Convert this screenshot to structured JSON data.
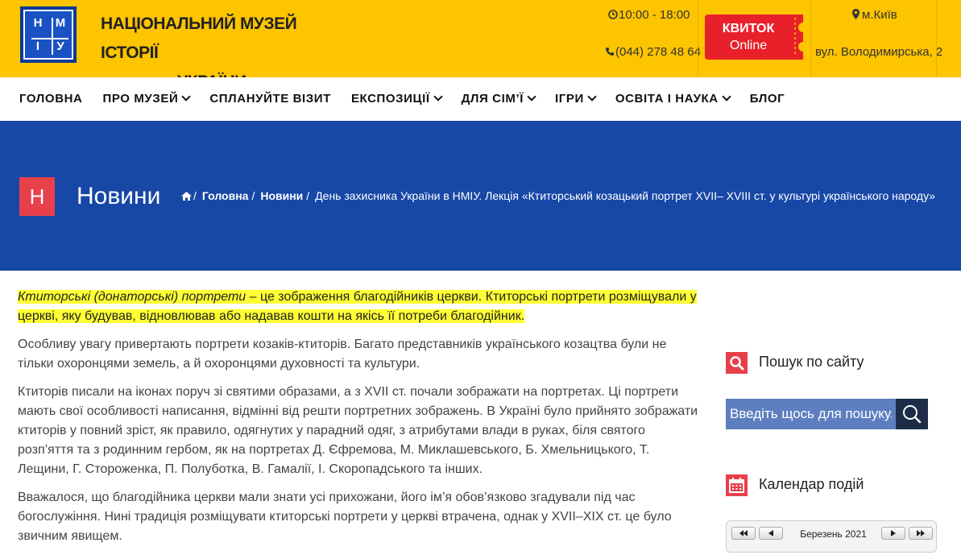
{
  "header": {
    "logo_letters": [
      "Н",
      "М",
      "І",
      "У"
    ],
    "museum_name_line1": "НАЦІОНАЛЬНИЙ МУЗЕЙ ІСТОРІЇ",
    "museum_name_line2": "УКРАЇНИ",
    "hours": "10:00 - 18:00",
    "phone": "(044) 278 48 64",
    "ticket_line1": "КВИТОК",
    "ticket_line2": "Online",
    "city": "м.Київ",
    "address": "вул. Володимирська, 2"
  },
  "nav": {
    "items": [
      {
        "label": "ГОЛОВНА"
      },
      {
        "label": "ПРО МУЗЕЙ"
      },
      {
        "label": "СПЛАНУЙТЕ ВІЗИТ"
      },
      {
        "label": "ЕКСПОЗИЦІЇ"
      },
      {
        "label": "ДЛЯ СІМ’Ї"
      },
      {
        "label": "ІГРИ"
      },
      {
        "label": "ОСВІТА І НАУКА"
      },
      {
        "label": "БЛОГ"
      }
    ]
  },
  "banner": {
    "badge_letter": "Н",
    "title": "Новини",
    "breadcrumb": [
      "Головна",
      "Новини",
      "День захисника України в НМІУ. Лекція «Ктиторський козацький портрет XVII– XVIII ст. у культурі українського народу»"
    ]
  },
  "article": {
    "highlight_term": "Ктиторські (донаторські) портрети",
    "highlight_rest": " – це зображення благодійників церкви. Ктиторські портрети розміщували у церкві, яку будував, відновлював або надавав кошти на якісь її потреби благодійник.",
    "p2": "Особливу увагу привертають портрети козаків-ктиторів. Багато представників українського козацтва були не тільки охоронцями земель, а й охоронцями духовності та культури.",
    "p3": "Ктиторів писали на іконах поруч зі святими образами, а з XVII ст. почали зображати на портретах. Ці портрети мають свої особливості написання, відмінні від решти портретних зображень. В Україні було прийнято зображати ктиторів у повний зріст, як правило, одягнутих у парадний одяг, з атрибутами влади в руках, біля святого розп’яття та з родинним гербом, як на портретах Д. Єфремова, М. Миклашевського, Б. Хмельницького, Т. Лещини, Г. Стороженка, П. Полуботка, В. Гамалії, І. Скоропадського та інших.",
    "p4": "Вважалося, що благодійника церкви мали знати усі прихожани, його ім’я обов’язково згадували під час богослужіння. Нині традиція розміщувати ктиторські портрети у церкві втрачена, однак у XVII–XIX ст. це було звичним явищем."
  },
  "sidebar": {
    "search_title": "Пошук по сайту",
    "search_placeholder": "Введіть щось для пошуку...",
    "calendar_title": "Календар подій",
    "calendar_month": "Березень 2021"
  },
  "colors": {
    "header_bg": "#fdc400",
    "banner_bg": "#1848a6",
    "accent_red": "#e8404b",
    "ticket_red": "#e8202a",
    "highlight": "#ffff33"
  },
  "icons": [
    "clock-icon",
    "phone-icon",
    "map-marker-icon",
    "home-icon",
    "search-icon",
    "calendar-icon",
    "chevron-down-icon"
  ]
}
